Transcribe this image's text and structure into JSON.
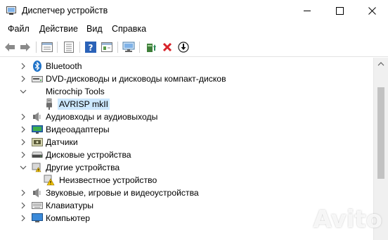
{
  "window": {
    "title": "Диспетчер устройств",
    "controls": {
      "minimize": "minimize",
      "maximize": "maximize",
      "close": "close"
    }
  },
  "menu": [
    {
      "label": "Файл"
    },
    {
      "label": "Действие"
    },
    {
      "label": "Вид"
    },
    {
      "label": "Справка"
    }
  ],
  "toolbar": {
    "buttons": [
      "back-arrow-icon",
      "forward-arrow-icon",
      "properties-icon",
      "list-view-icon",
      "help-icon",
      "action-view-icon",
      "scan-hardware-monitor-icon",
      "update-driver-icon",
      "uninstall-x-icon",
      "download-arrow-icon"
    ]
  },
  "tree": {
    "items": [
      {
        "label": "Bluetooth",
        "expanded": false,
        "icon": "bluetooth-icon"
      },
      {
        "label": "DVD-дисководы и дисководы компакт-дисков",
        "expanded": false,
        "icon": "dvd-drive-icon"
      },
      {
        "label": "Microchip Tools",
        "expanded": true,
        "icon": "none"
      },
      {
        "label": "AVRISP mkII",
        "child": true,
        "selected": true,
        "icon": "usb-plug-icon"
      },
      {
        "label": "Аудиовходы и аудиовыходы",
        "expanded": false,
        "icon": "speaker-icon"
      },
      {
        "label": "Видеоадаптеры",
        "expanded": false,
        "icon": "display-adapter-icon"
      },
      {
        "label": "Датчики",
        "expanded": false,
        "icon": "sensor-icon"
      },
      {
        "label": "Дисковые устройства",
        "expanded": false,
        "icon": "disk-drive-icon"
      },
      {
        "label": "Другие устройства",
        "expanded": true,
        "icon": "unknown-device-icon"
      },
      {
        "label": "Неизвестное устройство",
        "child": true,
        "icon": "warning-device-icon"
      },
      {
        "label": "Звуковые, игровые и видеоустройства",
        "expanded": false,
        "icon": "speaker-icon"
      },
      {
        "label": "Клавиатуры",
        "expanded": false,
        "icon": "keyboard-icon"
      },
      {
        "label": "Компьютер",
        "expanded": false,
        "icon": "computer-icon"
      }
    ]
  },
  "watermark": {
    "text": "Avito"
  },
  "colors": {
    "selection": "#cce8ff",
    "accent_blue": "#1e72c8",
    "error_red": "#e81123",
    "warning_yellow": "#f5c400"
  }
}
